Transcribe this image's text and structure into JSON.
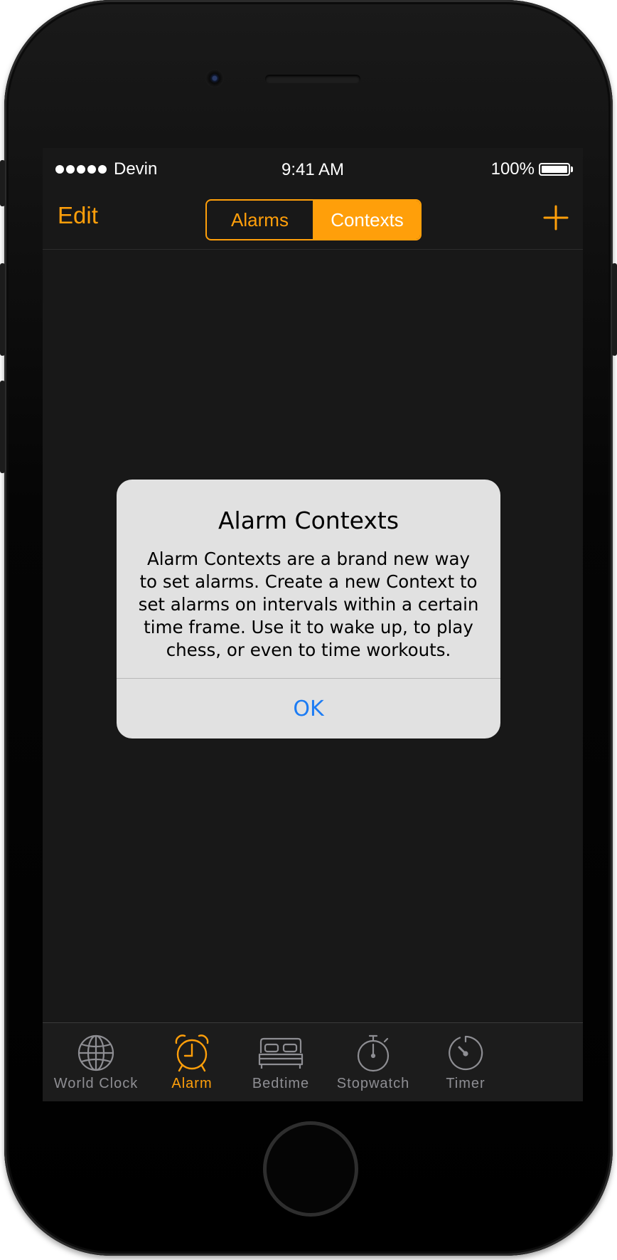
{
  "status_bar": {
    "signal_dots": 5,
    "carrier": "Devin",
    "time": "9:41 AM",
    "battery_percent": "100%"
  },
  "nav": {
    "edit_label": "Edit",
    "segments": [
      "Alarms",
      "Contexts"
    ],
    "selected_segment": "Contexts",
    "add_icon": "plus-icon"
  },
  "alert": {
    "title": "Alarm Contexts",
    "message": "Alarm Contexts are a brand new way to set alarms. Create a new Context to set alarms on intervals within a certain time frame. Use it to wake up, to play chess, or even to time workouts.",
    "ok_label": "OK"
  },
  "tabs": [
    {
      "label": "World Clock",
      "icon": "globe-icon",
      "active": false
    },
    {
      "label": "Alarm",
      "icon": "alarm-clock-icon",
      "active": true
    },
    {
      "label": "Bedtime",
      "icon": "bed-icon",
      "active": false
    },
    {
      "label": "Stopwatch",
      "icon": "stopwatch-icon",
      "active": false
    },
    {
      "label": "Timer",
      "icon": "timer-icon",
      "active": false
    }
  ],
  "colors": {
    "accent": "#ff9f0a",
    "inactive": "#8e8e93",
    "alert_button": "#1c7cf4",
    "screen_bg": "#181818",
    "alert_bg": "#e1e1e1"
  }
}
